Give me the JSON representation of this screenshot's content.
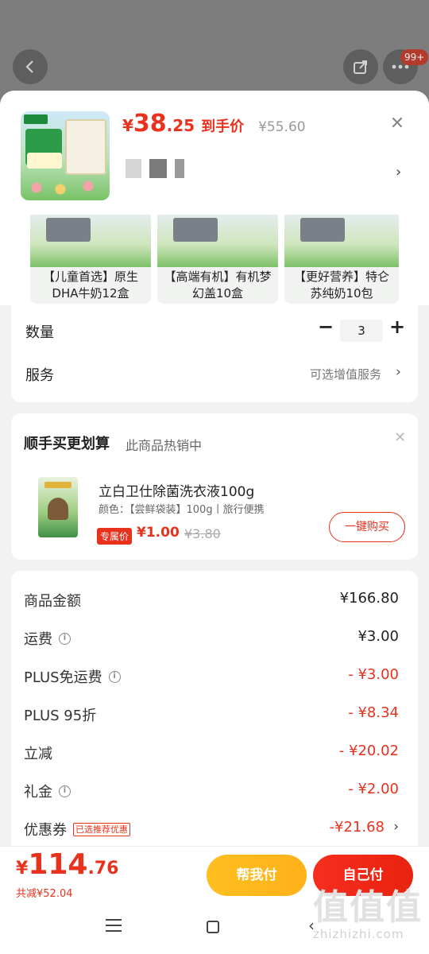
{
  "background_page": {
    "badge_count": "99+"
  },
  "sheet": {
    "product": {
      "price_currency": "¥",
      "price_int": "38",
      "price_dec": ".25",
      "price_suffix": "到手价",
      "original_price": "¥55.60"
    },
    "variants": [
      {
        "label": "【儿童首选】原生DHA牛奶12盒"
      },
      {
        "label": "【高端有机】有机梦幻盖10盒"
      },
      {
        "label": "【更好营养】特仑苏纯奶10包"
      }
    ],
    "quantity": {
      "label": "数量",
      "value": "3"
    },
    "service": {
      "label": "服务",
      "option": "可选增值服务"
    }
  },
  "addon": {
    "title": "顺手买更划算",
    "subtitle": "此商品热销中",
    "item_name": "立白卫仕除菌洗衣液100g",
    "item_spec": "颜色：【尝鲜袋装】100g丨旅行便携",
    "badge": "专属价",
    "price": "¥1.00",
    "original_price": "¥3.80",
    "button": "一键购买"
  },
  "fees": {
    "rows": [
      {
        "label": "商品金额",
        "value": "¥166.80"
      },
      {
        "label": "运费",
        "value": "¥3.00"
      },
      {
        "label": "PLUS免运费",
        "value": "- ¥3.00"
      },
      {
        "label": "PLUS 95折",
        "value": "- ¥8.34"
      },
      {
        "label": "立减",
        "value": "- ¥20.02"
      },
      {
        "label": "礼金",
        "value": "- ¥2.00"
      },
      {
        "label": "优惠券",
        "tag": "已选推荐优惠",
        "value": "-¥21.68"
      }
    ]
  },
  "bottom": {
    "total_currency": "¥",
    "total_int": "114",
    "total_dec": ".76",
    "saved": "共减¥52.04",
    "help_button": "帮我付",
    "pay_button": "自己付"
  },
  "watermark": {
    "big": "值值值",
    "small": "zhizhizhi.com"
  },
  "colors": {
    "accent_red": "#e8321e",
    "help_yellow": "#ffb91d"
  }
}
